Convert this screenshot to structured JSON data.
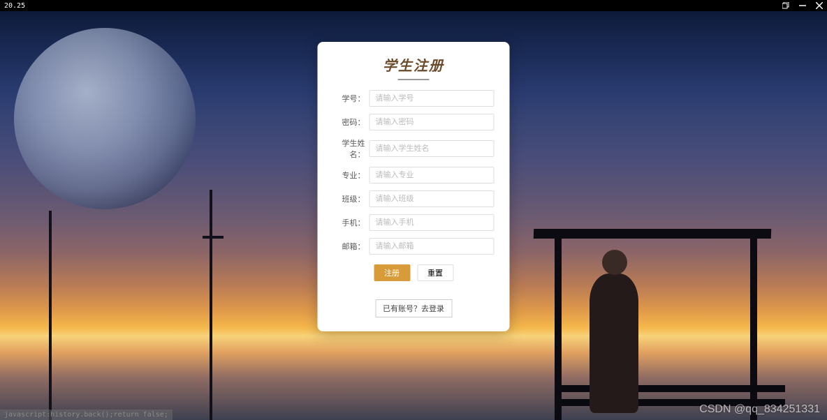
{
  "titlebar": {
    "left_text": "20.25"
  },
  "form": {
    "title": "学生注册",
    "fields": [
      {
        "label": "学号：",
        "placeholder": "请输入学号",
        "name": "student-id"
      },
      {
        "label": "密码：",
        "placeholder": "请输入密码",
        "name": "password"
      },
      {
        "label": "学生姓名：",
        "placeholder": "请输入学生姓名",
        "name": "student-name"
      },
      {
        "label": "专业：",
        "placeholder": "请输入专业",
        "name": "major"
      },
      {
        "label": "班级：",
        "placeholder": "请输入班级",
        "name": "class"
      },
      {
        "label": "手机：",
        "placeholder": "请输入手机",
        "name": "phone"
      },
      {
        "label": "邮箱：",
        "placeholder": "请输入邮箱",
        "name": "email"
      }
    ],
    "submit_label": "注册",
    "reset_label": "重置",
    "login_link": "已有账号？去登录"
  },
  "statusbar": {
    "text": "javascript:history.back();return false;"
  },
  "watermark": {
    "text": "CSDN @qq_834251331"
  }
}
